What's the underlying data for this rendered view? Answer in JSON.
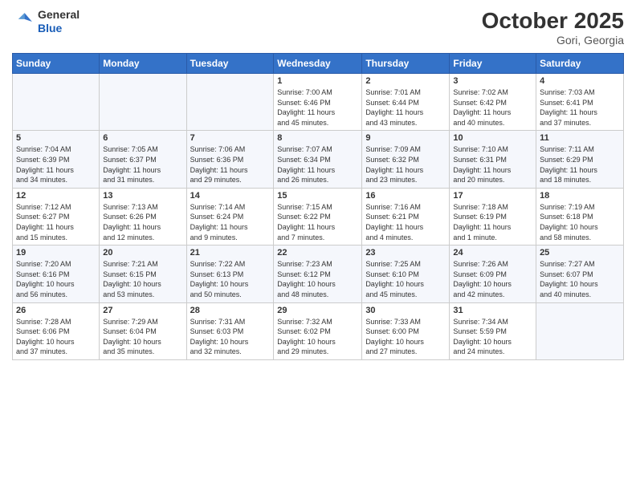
{
  "header": {
    "logo_general": "General",
    "logo_blue": "Blue",
    "month_title": "October 2025",
    "location": "Gori, Georgia"
  },
  "days_of_week": [
    "Sunday",
    "Monday",
    "Tuesday",
    "Wednesday",
    "Thursday",
    "Friday",
    "Saturday"
  ],
  "weeks": [
    [
      {
        "day": "",
        "info": ""
      },
      {
        "day": "",
        "info": ""
      },
      {
        "day": "",
        "info": ""
      },
      {
        "day": "1",
        "info": "Sunrise: 7:00 AM\nSunset: 6:46 PM\nDaylight: 11 hours\nand 45 minutes."
      },
      {
        "day": "2",
        "info": "Sunrise: 7:01 AM\nSunset: 6:44 PM\nDaylight: 11 hours\nand 43 minutes."
      },
      {
        "day": "3",
        "info": "Sunrise: 7:02 AM\nSunset: 6:42 PM\nDaylight: 11 hours\nand 40 minutes."
      },
      {
        "day": "4",
        "info": "Sunrise: 7:03 AM\nSunset: 6:41 PM\nDaylight: 11 hours\nand 37 minutes."
      }
    ],
    [
      {
        "day": "5",
        "info": "Sunrise: 7:04 AM\nSunset: 6:39 PM\nDaylight: 11 hours\nand 34 minutes."
      },
      {
        "day": "6",
        "info": "Sunrise: 7:05 AM\nSunset: 6:37 PM\nDaylight: 11 hours\nand 31 minutes."
      },
      {
        "day": "7",
        "info": "Sunrise: 7:06 AM\nSunset: 6:36 PM\nDaylight: 11 hours\nand 29 minutes."
      },
      {
        "day": "8",
        "info": "Sunrise: 7:07 AM\nSunset: 6:34 PM\nDaylight: 11 hours\nand 26 minutes."
      },
      {
        "day": "9",
        "info": "Sunrise: 7:09 AM\nSunset: 6:32 PM\nDaylight: 11 hours\nand 23 minutes."
      },
      {
        "day": "10",
        "info": "Sunrise: 7:10 AM\nSunset: 6:31 PM\nDaylight: 11 hours\nand 20 minutes."
      },
      {
        "day": "11",
        "info": "Sunrise: 7:11 AM\nSunset: 6:29 PM\nDaylight: 11 hours\nand 18 minutes."
      }
    ],
    [
      {
        "day": "12",
        "info": "Sunrise: 7:12 AM\nSunset: 6:27 PM\nDaylight: 11 hours\nand 15 minutes."
      },
      {
        "day": "13",
        "info": "Sunrise: 7:13 AM\nSunset: 6:26 PM\nDaylight: 11 hours\nand 12 minutes."
      },
      {
        "day": "14",
        "info": "Sunrise: 7:14 AM\nSunset: 6:24 PM\nDaylight: 11 hours\nand 9 minutes."
      },
      {
        "day": "15",
        "info": "Sunrise: 7:15 AM\nSunset: 6:22 PM\nDaylight: 11 hours\nand 7 minutes."
      },
      {
        "day": "16",
        "info": "Sunrise: 7:16 AM\nSunset: 6:21 PM\nDaylight: 11 hours\nand 4 minutes."
      },
      {
        "day": "17",
        "info": "Sunrise: 7:18 AM\nSunset: 6:19 PM\nDaylight: 11 hours\nand 1 minute."
      },
      {
        "day": "18",
        "info": "Sunrise: 7:19 AM\nSunset: 6:18 PM\nDaylight: 10 hours\nand 58 minutes."
      }
    ],
    [
      {
        "day": "19",
        "info": "Sunrise: 7:20 AM\nSunset: 6:16 PM\nDaylight: 10 hours\nand 56 minutes."
      },
      {
        "day": "20",
        "info": "Sunrise: 7:21 AM\nSunset: 6:15 PM\nDaylight: 10 hours\nand 53 minutes."
      },
      {
        "day": "21",
        "info": "Sunrise: 7:22 AM\nSunset: 6:13 PM\nDaylight: 10 hours\nand 50 minutes."
      },
      {
        "day": "22",
        "info": "Sunrise: 7:23 AM\nSunset: 6:12 PM\nDaylight: 10 hours\nand 48 minutes."
      },
      {
        "day": "23",
        "info": "Sunrise: 7:25 AM\nSunset: 6:10 PM\nDaylight: 10 hours\nand 45 minutes."
      },
      {
        "day": "24",
        "info": "Sunrise: 7:26 AM\nSunset: 6:09 PM\nDaylight: 10 hours\nand 42 minutes."
      },
      {
        "day": "25",
        "info": "Sunrise: 7:27 AM\nSunset: 6:07 PM\nDaylight: 10 hours\nand 40 minutes."
      }
    ],
    [
      {
        "day": "26",
        "info": "Sunrise: 7:28 AM\nSunset: 6:06 PM\nDaylight: 10 hours\nand 37 minutes."
      },
      {
        "day": "27",
        "info": "Sunrise: 7:29 AM\nSunset: 6:04 PM\nDaylight: 10 hours\nand 35 minutes."
      },
      {
        "day": "28",
        "info": "Sunrise: 7:31 AM\nSunset: 6:03 PM\nDaylight: 10 hours\nand 32 minutes."
      },
      {
        "day": "29",
        "info": "Sunrise: 7:32 AM\nSunset: 6:02 PM\nDaylight: 10 hours\nand 29 minutes."
      },
      {
        "day": "30",
        "info": "Sunrise: 7:33 AM\nSunset: 6:00 PM\nDaylight: 10 hours\nand 27 minutes."
      },
      {
        "day": "31",
        "info": "Sunrise: 7:34 AM\nSunset: 5:59 PM\nDaylight: 10 hours\nand 24 minutes."
      },
      {
        "day": "",
        "info": ""
      }
    ]
  ]
}
